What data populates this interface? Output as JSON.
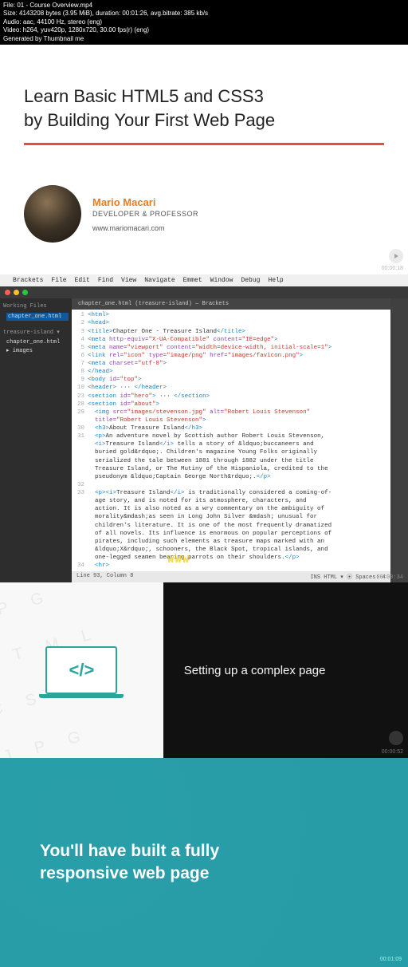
{
  "meta": {
    "line1": "File: 01 - Course Overview.mp4",
    "line2": "Size: 4143208 bytes (3.95 MiB), duration: 00:01:26, avg.bitrate: 385 kb/s",
    "line3": "Audio: aac, 44100 Hz, stereo (eng)",
    "line4": "Video: h264, yuv420p, 1280x720, 30.00 fps(r) (eng)",
    "line5": "Generated by Thumbnail me"
  },
  "course": {
    "title_line1": "Learn Basic HTML5 and CSS3",
    "title_line2": "by Building Your First Web Page"
  },
  "author": {
    "name": "Mario Macari",
    "role": "DEVELOPER & PROFESSOR",
    "site": "www.mariomacari.com",
    "timestamp": "00:00:18"
  },
  "menubar": {
    "items": [
      "Brackets",
      "File",
      "Edit",
      "Find",
      "View",
      "Navigate",
      "Emmet",
      "Window",
      "Debug",
      "Help"
    ]
  },
  "sidebar": {
    "working_files": "Working Files",
    "file1": "chapter_one.html",
    "project": "treasure-island ▾",
    "file2": "chapter_one.html",
    "folder": "▸ images"
  },
  "tab": "chapter_one.html (treasure-island) — Brackets",
  "code_lines": [
    {
      "n": "1",
      "html": "<span class='tag'>&lt;html&gt;</span>"
    },
    {
      "n": "2",
      "html": "<span class='tag'>&lt;head&gt;</span>"
    },
    {
      "n": "3",
      "html": "<span class='tag'>&lt;title&gt;</span><span class='txt'>Chapter One - Treasure Island</span><span class='tag'>&lt;/title&gt;</span>"
    },
    {
      "n": "4",
      "html": "<span class='tag'>&lt;meta </span><span class='attr'>http-equiv=</span><span class='str'>\"X-UA-Compatible\"</span> <span class='attr'>content=</span><span class='str'>\"IE=edge\"</span><span class='tag'>&gt;</span>"
    },
    {
      "n": "5",
      "html": "<span class='tag'>&lt;meta </span><span class='attr'>name=</span><span class='str'>\"viewport\"</span> <span class='attr'>content=</span><span class='str'>\"width=device-width, initial-scale=1\"</span><span class='tag'>&gt;</span>"
    },
    {
      "n": "6",
      "html": "<span class='tag'>&lt;link </span><span class='attr'>rel=</span><span class='str'>\"icon\"</span> <span class='attr'>type=</span><span class='str'>\"image/png\"</span> <span class='attr'>href=</span><span class='str'>\"images/favicon.png\"</span><span class='tag'>&gt;</span>"
    },
    {
      "n": "7",
      "html": "<span class='tag'>&lt;meta </span><span class='attr'>charset=</span><span class='str'>\"utf-8\"</span><span class='tag'>&gt;</span>"
    },
    {
      "n": "8",
      "html": "<span class='tag'>&lt;/head&gt;</span>"
    },
    {
      "n": "9",
      "html": "<span class='tag'>&lt;body </span><span class='attr'>id=</span><span class='str'>\"top\"</span><span class='tag'>&gt;</span>"
    },
    {
      "n": "10",
      "html": "<span class='tag'>&lt;header&gt;</span> ··· <span class='tag'>&lt;/header&gt;</span>"
    },
    {
      "n": "23",
      "html": "<span class='tag'>&lt;section </span><span class='attr'>id=</span><span class='str'>\"hero\"</span><span class='tag'>&gt;</span> ··· <span class='tag'>&lt;/section&gt;</span>"
    },
    {
      "n": "28",
      "html": "<span class='tag'>&lt;section </span><span class='attr'>id=</span><span class='str'>\"about\"</span><span class='tag'>&gt;</span>"
    },
    {
      "n": "29",
      "html": "  <span class='tag'>&lt;img </span><span class='attr'>src=</span><span class='str'>\"images/stevenson.jpg\"</span> <span class='attr'>alt=</span><span class='str'>\"Robert Louis Stevenson\"</span>"
    },
    {
      "n": "",
      "html": "  <span class='attr'>title=</span><span class='str'>\"Robert Louis Stevenson\"</span><span class='tag'>&gt;</span>"
    },
    {
      "n": "30",
      "html": "  <span class='tag'>&lt;h3&gt;</span><span class='txt'>About Treasure Island</span><span class='tag'>&lt;/h3&gt;</span>"
    },
    {
      "n": "31",
      "html": "  <span class='tag'>&lt;p&gt;</span><span class='txt'>An adventure novel by Scottish author Robert Louis Stevenson,</span>"
    },
    {
      "n": "",
      "html": "  <span class='tag'>&lt;i&gt;</span><span class='txt'>Treasure Island</span><span class='tag'>&lt;/i&gt;</span> <span class='txt'>tells a story of &amp;ldquo;buccaneers and</span>"
    },
    {
      "n": "",
      "html": "  <span class='txt'>buried gold&amp;rdquo;. Children's magazine Young Folks originally</span>"
    },
    {
      "n": "",
      "html": "  <span class='txt'>serialized the tale between 1881 through 1882 under the title</span>"
    },
    {
      "n": "",
      "html": "  <span class='txt'>Treasure Island, or The Mutiny of the Hispaniola, credited to the</span>"
    },
    {
      "n": "",
      "html": "  <span class='txt'>pseudonym &amp;ldquo;Captain George North&amp;rdquo;.</span><span class='tag'>&lt;/p&gt;</span>"
    },
    {
      "n": "32",
      "html": ""
    },
    {
      "n": "33",
      "html": "  <span class='tag'>&lt;p&gt;&lt;i&gt;</span><span class='txt'>Treasure Island</span><span class='tag'>&lt;/i&gt;</span> <span class='txt'>is traditionally considered a coming-of-</span>"
    },
    {
      "n": "",
      "html": "  <span class='txt'>age story, and is noted for its atmosphere, characters, and</span>"
    },
    {
      "n": "",
      "html": "  <span class='txt'>action. It is also noted as a wry commentary on the ambiguity of</span>"
    },
    {
      "n": "",
      "html": "  <span class='txt'>morality&amp;mdash;as seen in Long John Silver &amp;mdash; unusual for</span>"
    },
    {
      "n": "",
      "html": "  <span class='txt'>children's literature. It is one of the most frequently dramatized</span>"
    },
    {
      "n": "",
      "html": "  <span class='txt'>of all novels. Its influence is enormous on popular perceptions of</span>"
    },
    {
      "n": "",
      "html": "  <span class='txt'>pirates, including such elements as treasure maps marked with an</span>"
    },
    {
      "n": "",
      "html": "  <span class='txt'>&amp;ldquo;X&amp;rdquo;, schooners, the Black Spot, tropical islands, and</span>"
    },
    {
      "n": "",
      "html": "  <span class='txt'>one-legged seamen bearing parrots on their shoulders.</span><span class='tag'>&lt;/p&gt;</span>"
    },
    {
      "n": "34",
      "html": "  <span class='tag'>&lt;hr&gt;</span>"
    }
  ],
  "statusbar": {
    "left": "Line 93, Column 8",
    "right": "INS   HTML ▾   ⦿ Spaces: 4"
  },
  "editor_ts": "00:00:34",
  "slide2": {
    "text": "Setting up a complex page",
    "timestamp": "00:00:52"
  },
  "slide3": {
    "line1": "You'll have built a fully",
    "line2": "responsive web page",
    "timestamp": "00:01:09"
  },
  "watermark": "WWW"
}
